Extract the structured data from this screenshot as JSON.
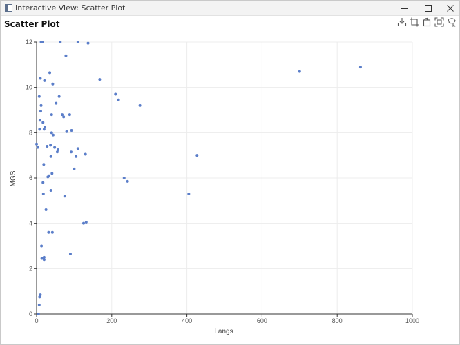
{
  "window": {
    "title": "Interactive View: Scatter Plot",
    "minimize_icon": "minimize-icon",
    "maximize_icon": "maximize-icon",
    "close_icon": "close-icon"
  },
  "toolbar": {
    "icons": [
      "download-icon",
      "crop-icon",
      "rotate-crop-icon",
      "expand-icon",
      "lasso-select-icon"
    ]
  },
  "colors": {
    "point": "#5b7ec9",
    "grid": "#ececec",
    "axis": "#333333",
    "tick_label": "#555555"
  },
  "chart_data": {
    "type": "scatter",
    "title": "Scatter Plot",
    "xlabel": "Langs",
    "ylabel": "MGS",
    "xlim": [
      0,
      1000
    ],
    "ylim": [
      0,
      12
    ],
    "xticks": [
      0,
      200,
      400,
      600,
      800,
      1000
    ],
    "yticks": [
      0,
      2,
      4,
      6,
      8,
      10,
      12
    ],
    "grid": true,
    "points": [
      [
        0,
        7.5
      ],
      [
        3,
        7.35
      ],
      [
        5,
        0.0
      ],
      [
        7,
        0.4
      ],
      [
        8,
        0.75
      ],
      [
        10,
        0.85
      ],
      [
        7,
        9.6
      ],
      [
        8,
        8.15
      ],
      [
        9,
        8.55
      ],
      [
        11,
        8.95
      ],
      [
        10,
        10.4
      ],
      [
        12,
        9.2
      ],
      [
        12,
        12.0
      ],
      [
        15,
        12.0
      ],
      [
        13,
        3.0
      ],
      [
        14,
        2.45
      ],
      [
        17,
        5.8
      ],
      [
        18,
        5.3
      ],
      [
        17,
        8.45
      ],
      [
        19,
        6.6
      ],
      [
        20,
        8.15
      ],
      [
        22,
        8.25
      ],
      [
        21,
        10.3
      ],
      [
        20,
        2.5
      ],
      [
        20,
        2.4
      ],
      [
        25,
        4.6
      ],
      [
        28,
        7.4
      ],
      [
        30,
        6.05
      ],
      [
        32,
        3.6
      ],
      [
        35,
        10.65
      ],
      [
        33,
        6.1
      ],
      [
        37,
        7.45
      ],
      [
        38,
        5.45
      ],
      [
        38,
        6.95
      ],
      [
        40,
        8.8
      ],
      [
        40,
        8.0
      ],
      [
        41,
        6.2
      ],
      [
        42,
        3.6
      ],
      [
        43,
        10.15
      ],
      [
        44,
        7.9
      ],
      [
        48,
        7.35
      ],
      [
        52,
        9.3
      ],
      [
        55,
        7.15
      ],
      [
        57,
        7.25
      ],
      [
        60,
        9.6
      ],
      [
        63,
        12.0
      ],
      [
        68,
        8.8
      ],
      [
        72,
        8.7
      ],
      [
        75,
        5.2
      ],
      [
        78,
        11.4
      ],
      [
        80,
        8.05
      ],
      [
        88,
        8.8
      ],
      [
        90,
        2.65
      ],
      [
        92,
        7.15
      ],
      [
        93,
        8.1
      ],
      [
        100,
        6.4
      ],
      [
        105,
        6.95
      ],
      [
        110,
        7.3
      ],
      [
        110,
        12.0
      ],
      [
        125,
        4.0
      ],
      [
        130,
        7.05
      ],
      [
        132,
        4.05
      ],
      [
        137,
        11.95
      ],
      [
        168,
        10.35
      ],
      [
        210,
        9.7
      ],
      [
        218,
        9.45
      ],
      [
        233,
        6.0
      ],
      [
        242,
        5.85
      ],
      [
        275,
        9.2
      ],
      [
        405,
        5.3
      ],
      [
        427,
        7.0
      ],
      [
        700,
        10.7
      ],
      [
        862,
        10.9
      ]
    ]
  }
}
